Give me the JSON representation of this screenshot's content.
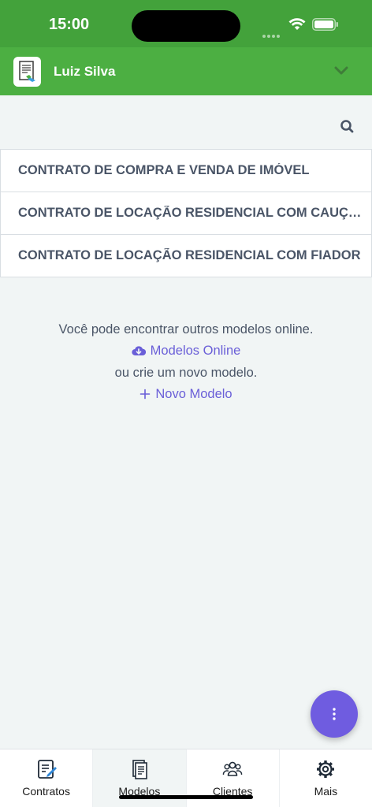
{
  "status_bar": {
    "time": "15:00"
  },
  "header": {
    "user_name": "Luiz Silva"
  },
  "templates": [
    {
      "title": "CONTRATO DE COMPRA E VENDA DE IMÓVEL"
    },
    {
      "title": "CONTRATO DE LOCAÇÃO RESIDENCIAL COM CAUÇÃO"
    },
    {
      "title": "CONTRATO DE LOCAÇÃO RESIDENCIAL COM FIADOR"
    }
  ],
  "empty_state": {
    "line1": "Você pode encontrar outros modelos online.",
    "online_link": "Modelos Online",
    "line2": "ou crie um novo modelo.",
    "new_link": "Novo Modelo"
  },
  "bottom_nav": {
    "items": [
      {
        "label": "Contratos",
        "icon": "contract-icon"
      },
      {
        "label": "Modelos",
        "icon": "templates-icon",
        "active": true
      },
      {
        "label": "Clientes",
        "icon": "clients-icon"
      },
      {
        "label": "Mais",
        "icon": "gear-icon"
      }
    ]
  },
  "colors": {
    "brand_green": "#4caf42",
    "accent_purple": "#6f5ce0",
    "link_purple": "#6a5fd8"
  }
}
